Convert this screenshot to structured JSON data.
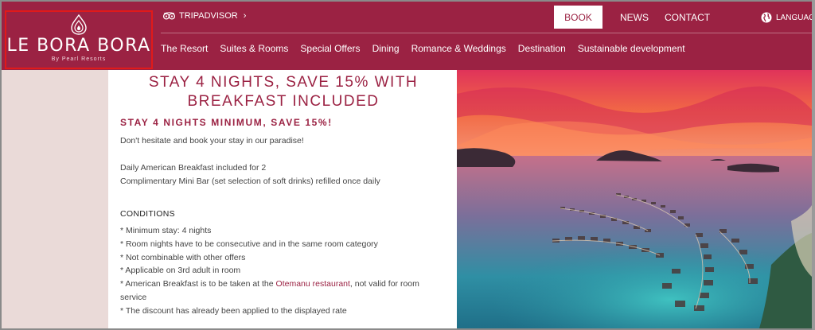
{
  "logo": {
    "name": "LE BORA BORA",
    "tagline": "By Pearl Resorts"
  },
  "topbar": {
    "tripadvisor_label": "TRIPADVISOR",
    "book_label": "BOOK",
    "news_label": "NEWS",
    "contact_label": "CONTACT",
    "language_label": "LANGUAGE"
  },
  "nav": {
    "items": [
      "The Resort",
      "Suites & Rooms",
      "Special Offers",
      "Dining",
      "Romance & Weddings",
      "Destination",
      "Sustainable development"
    ]
  },
  "offer": {
    "title_line1": "STAY 4 NIGHTS, SAVE 15% WITH",
    "title_line2": "BREAKFAST INCLUDED",
    "subtitle": "STAY 4 NIGHTS MINIMUM, SAVE 15%!",
    "intro": "Don't hesitate and book your stay in our paradise!",
    "perk1": "Daily American Breakfast included for 2",
    "perk2": "Complimentary Mini Bar (set selection of soft drinks) refilled once daily",
    "conditions_title": "CONDITIONS",
    "conditions": [
      "* Minimum stay: 4 nights",
      "* Room nights have to be consecutive and in the same room category",
      "* Not combinable with other offers",
      "* Applicable on 3rd adult in room"
    ],
    "condition5_pre": "* American Breakfast is to be taken at the ",
    "condition5_link": "Otemanu restaurant",
    "condition5_post": ", not valid for room service",
    "condition6": "* The discount has already been applied to the displayed rate"
  },
  "colors": {
    "brand": "#9b2243",
    "logo_highlight": "#e01a1a",
    "side_band": "#eadad8"
  }
}
